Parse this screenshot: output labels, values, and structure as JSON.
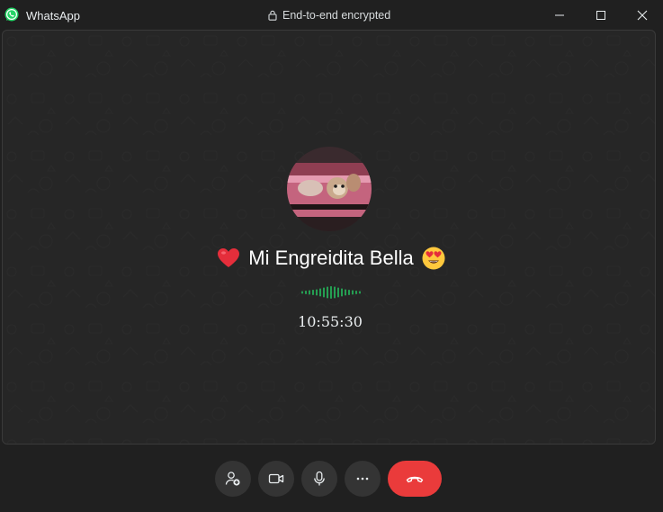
{
  "titlebar": {
    "app_name": "WhatsApp",
    "encryption_label": "End-to-end encrypted",
    "icons": [
      "whatsapp-logo",
      "lock-icon",
      "minimize-icon",
      "maximize-icon",
      "close-icon"
    ]
  },
  "call": {
    "contact_name": "Mi Engreidita  Bella",
    "name_prefix_emoji": "red-heart",
    "name_suffix_emoji": "heart-eyes-face",
    "duration": "10:55:30",
    "audio_indicator": "green-waveform"
  },
  "controls": {
    "buttons": [
      "add-participant",
      "video",
      "microphone",
      "more-options",
      "end-call"
    ]
  },
  "colors": {
    "background": "#202020",
    "panel": "#262626",
    "button": "#343434",
    "end_call": "#ea3b3b",
    "waveform": "#25d366"
  }
}
